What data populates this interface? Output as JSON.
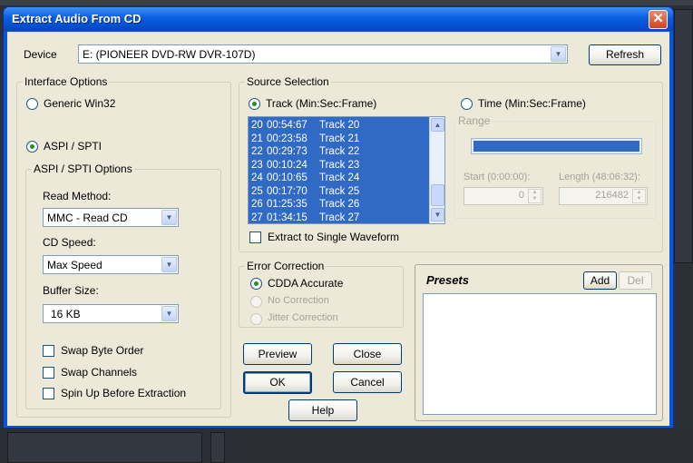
{
  "dialog": {
    "title": "Extract Audio From CD",
    "close_glyph": "✕"
  },
  "device": {
    "label": "Device",
    "value": "E: (PIONEER DVD-RW  DVR-107D)",
    "refresh_label": "Refresh"
  },
  "interface": {
    "group_title": "Interface Options",
    "generic_label": "Generic Win32",
    "aspi_label": "ASPI / SPTI",
    "selected": "ASPI / SPTI",
    "aspi_options": {
      "group_title": "ASPI / SPTI Options",
      "read_method_label": "Read Method:",
      "read_method_value": "MMC - Read CD",
      "cd_speed_label": "CD Speed:",
      "cd_speed_value": "Max Speed",
      "buffer_size_label": "Buffer Size:",
      "buffer_size_value": "16 KB",
      "swap_byte_order_label": "Swap Byte Order",
      "swap_channels_label": "Swap Channels",
      "spin_up_label": "Spin Up Before Extraction"
    }
  },
  "source": {
    "group_title": "Source Selection",
    "track_label": "Track (Min:Sec:Frame)",
    "time_label": "Time (Min:Sec:Frame)",
    "selected": "Track (Min:Sec:Frame)",
    "tracks": [
      {
        "num": "20",
        "time": "00:54:67",
        "name": "Track 20"
      },
      {
        "num": "21",
        "time": "00:23:58",
        "name": "Track 21"
      },
      {
        "num": "22",
        "time": "00:29:73",
        "name": "Track 22"
      },
      {
        "num": "23",
        "time": "00:10:24",
        "name": "Track 23"
      },
      {
        "num": "24",
        "time": "00:10:65",
        "name": "Track 24"
      },
      {
        "num": "25",
        "time": "00:17:70",
        "name": "Track 25"
      },
      {
        "num": "26",
        "time": "01:25:35",
        "name": "Track 26"
      },
      {
        "num": "27",
        "time": "01:34:15",
        "name": "Track 27"
      }
    ],
    "range_label": "Range",
    "start_label": "Start (0:00:00):",
    "length_label": "Length (48:06:32):",
    "start_value": "0",
    "length_value": "216482",
    "single_waveform_label": "Extract to Single Waveform"
  },
  "error_correction": {
    "group_title": "Error Correction",
    "cdda_label": "CDDA Accurate",
    "no_correction_label": "No Correction",
    "jitter_label": "Jitter Correction",
    "selected": "CDDA Accurate"
  },
  "presets": {
    "title": "Presets",
    "add_label": "Add",
    "del_label": "Del"
  },
  "buttons": {
    "preview": "Preview",
    "close": "Close",
    "ok": "OK",
    "cancel": "Cancel",
    "help": "Help"
  },
  "colors": {
    "titlebar": "#0a5ee0",
    "dialog_bg": "#ece9d8",
    "selection": "#316ac5",
    "close_button": "#d2441f"
  }
}
